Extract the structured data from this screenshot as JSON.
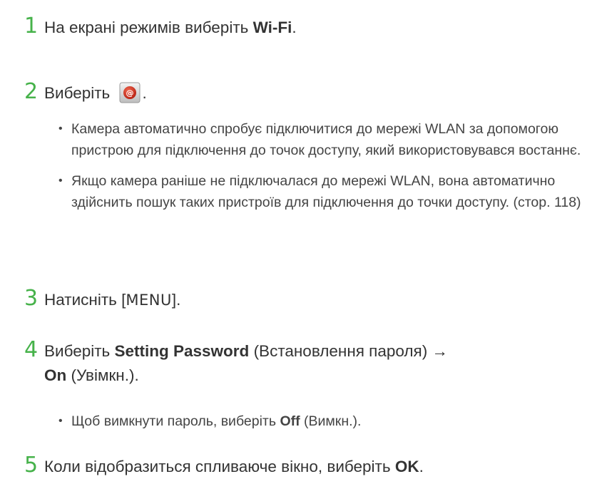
{
  "steps": [
    {
      "number": "1",
      "text_before": "На екрані режимів виберіть ",
      "bold": "Wi-Fi",
      "text_after": "."
    },
    {
      "number": "2",
      "text_before": "Виберіть ",
      "icon": "wifi-email-icon",
      "text_after": ".",
      "bullets": [
        "Камера автоматично спробує підключитися до мережі WLAN за допомогою пристрою для підключення до точок доступу, який використовувався востаннє.",
        "Якщо камера раніше не підключалася до мережі WLAN, вона автоматично здійснить пошук таких пристроїв для підключення до точки доступу. (стор. 118)"
      ]
    },
    {
      "number": "3",
      "text_before": "Натисніть [",
      "key": "MENU",
      "text_after": "]."
    },
    {
      "number": "4",
      "bold_1": "Setting Password",
      "text_1": " (Встановлення пароля) →",
      "bold_2": "On",
      "text_2": " (Увімкн.).",
      "bullet_before": "Щоб вимкнути пароль, виберіть ",
      "bullet_bold": "Off",
      "bullet_after": " (Вимкн.).",
      "text_before": "Виберіть "
    },
    {
      "number": "5",
      "text_before": "Коли відобразиться спливаюче вікно, виберіть ",
      "bold": "OK",
      "text_after": "."
    }
  ],
  "colors": {
    "step_number": "#46b24a",
    "text": "#333333",
    "icon_red": "#d8321f"
  }
}
